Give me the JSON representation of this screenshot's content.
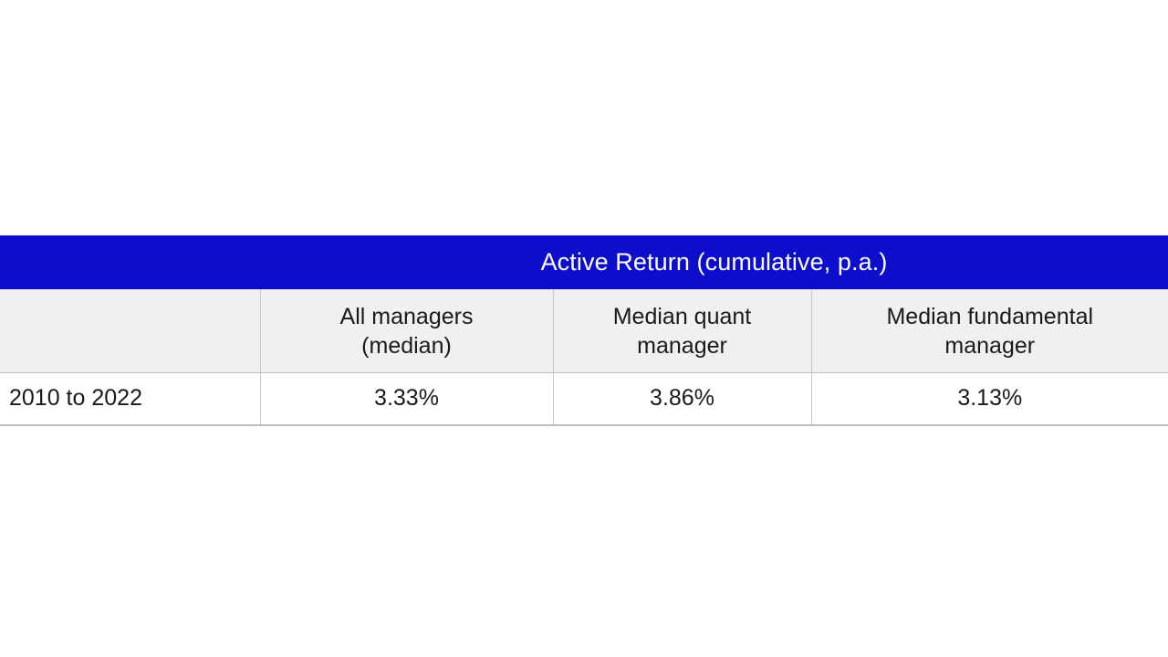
{
  "table": {
    "group_header": {
      "row_label_cell": "",
      "title": "Active Return (cumulative, p.a.)"
    },
    "column_headers": [
      "",
      "All managers\n(median)",
      "Median quant\nmanager",
      "Median fundamental\nmanager"
    ],
    "column_headers_lines": {
      "col1_line1": "All managers",
      "col1_line2": "(median)",
      "col2_line1": "Median quant",
      "col2_line2": "manager",
      "col3_line1": "Median fundamental",
      "col3_line2": "manager"
    },
    "rows": [
      {
        "label": "2010 to 2022",
        "all_managers_median": "3.33%",
        "median_quant_manager": "3.86%",
        "median_fundamental_manager": "3.13%"
      }
    ]
  },
  "colors": {
    "header_blue": "#0d0dcc",
    "header_text": "#ffffff",
    "subheader_gray": "#f0f0f0",
    "body_text": "#1a1a1a",
    "border_gray": "#c8c8c8",
    "page_background": "#ffffff"
  }
}
